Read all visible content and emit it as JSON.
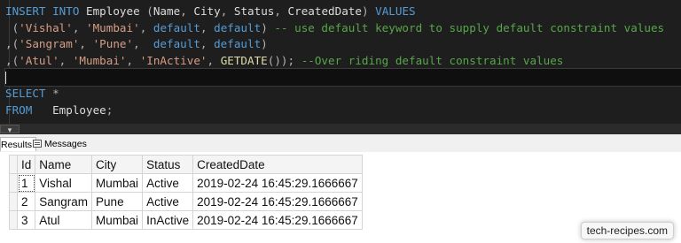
{
  "editor": {
    "lines": [
      [
        [
          "kw",
          "INSERT INTO "
        ],
        [
          "id",
          "Employee "
        ],
        [
          "op",
          "("
        ],
        [
          "id",
          "Name"
        ],
        [
          "op",
          ", "
        ],
        [
          "id",
          "City"
        ],
        [
          "op",
          ", "
        ],
        [
          "id",
          "Status"
        ],
        [
          "op",
          ", "
        ],
        [
          "id",
          "CreatedDate"
        ],
        [
          "op",
          ") "
        ],
        [
          "kw",
          "VALUES"
        ]
      ],
      [
        [
          "op",
          " ("
        ],
        [
          "str",
          "'Vishal'"
        ],
        [
          "op",
          ", "
        ],
        [
          "str",
          "'Mumbai'"
        ],
        [
          "op",
          ", "
        ],
        [
          "kw",
          "default"
        ],
        [
          "op",
          ", "
        ],
        [
          "kw",
          "default"
        ],
        [
          "op",
          ") "
        ],
        [
          "cm",
          "-- use default keyword to supply default constraint values"
        ]
      ],
      [
        [
          "op",
          ",("
        ],
        [
          "str",
          "'Sangram'"
        ],
        [
          "op",
          ", "
        ],
        [
          "str",
          "'Pune'"
        ],
        [
          "op",
          ",  "
        ],
        [
          "kw",
          "default"
        ],
        [
          "op",
          ", "
        ],
        [
          "kw",
          "default"
        ],
        [
          "op",
          ")"
        ]
      ],
      [
        [
          "op",
          ",("
        ],
        [
          "str",
          "'Atul'"
        ],
        [
          "op",
          ", "
        ],
        [
          "str",
          "'Mumbai'"
        ],
        [
          "op",
          ", "
        ],
        [
          "str",
          "'InActive'"
        ],
        [
          "op",
          ", "
        ],
        [
          "fn",
          "GETDATE"
        ],
        [
          "op",
          "()); "
        ],
        [
          "cm",
          "--Over riding default constraint values"
        ]
      ],
      [],
      [
        [
          "kw",
          "SELECT "
        ],
        [
          "op",
          "*"
        ]
      ],
      [
        [
          "kw",
          "FROM   "
        ],
        [
          "id",
          "Employee"
        ],
        [
          "op",
          ";"
        ]
      ]
    ]
  },
  "tabs": {
    "results": "Results",
    "messages": "Messages"
  },
  "grid": {
    "columns": [
      "Id",
      "Name",
      "City",
      "Status",
      "CreatedDate"
    ],
    "rows": [
      {
        "rownum": "1",
        "cells": [
          "Vishal",
          "Mumbai",
          "Active",
          "2019-02-24 16:45:29.1666667"
        ]
      },
      {
        "rownum": "2",
        "cells": [
          "Sangram",
          "Pune",
          "Active",
          "2019-02-24 16:45:29.1666667"
        ]
      },
      {
        "rownum": "3",
        "cells": [
          "Atul",
          "Mumbai",
          "InActive",
          "2019-02-24 16:45:29.1666667"
        ]
      }
    ]
  },
  "watermark": "tech-recipes.com"
}
